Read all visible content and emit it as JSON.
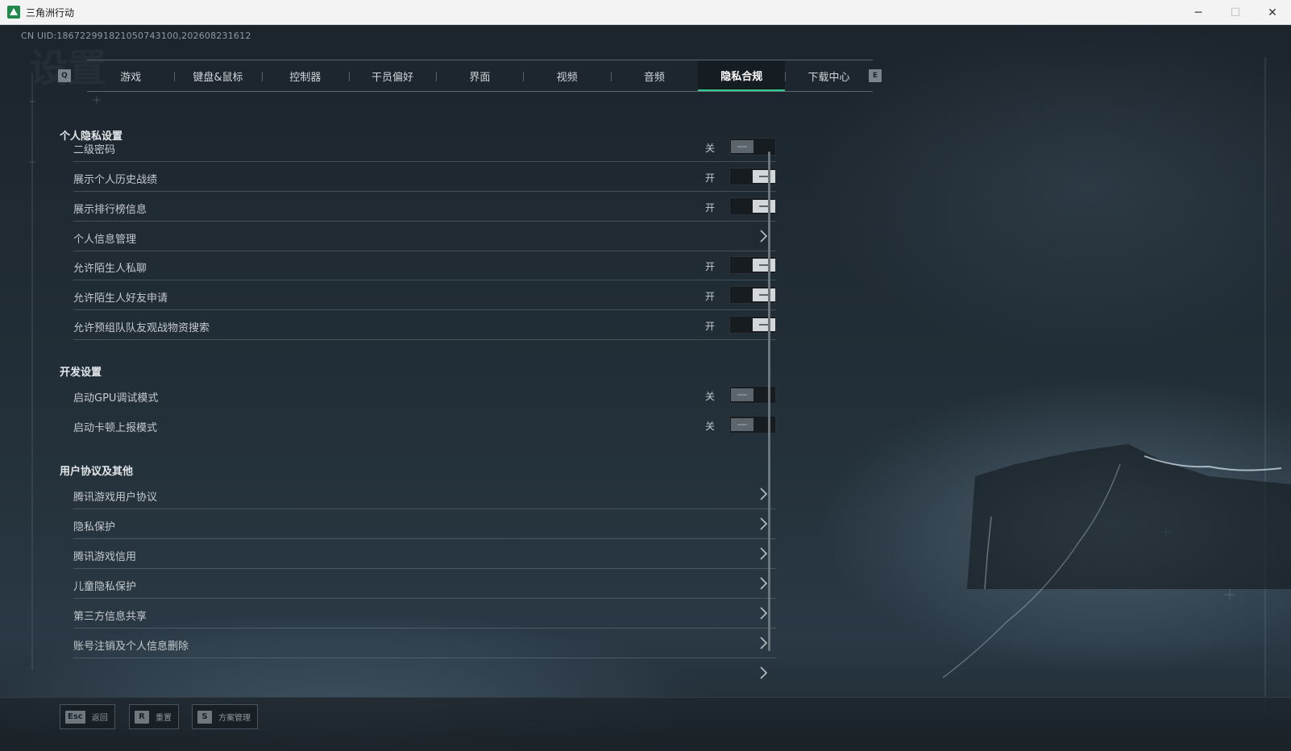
{
  "window": {
    "title": "三角洲行动",
    "minimize_glyph": "─",
    "maximize_glyph": "☐",
    "close_glyph": "✕"
  },
  "uid_text": "CN UID:18672299182105074310​0,202608231612",
  "watermark": "设置",
  "tabs": {
    "prev_key": "Q",
    "next_key": "E",
    "items": [
      {
        "label": "游戏"
      },
      {
        "label": "键盘&鼠标"
      },
      {
        "label": "控制器"
      },
      {
        "label": "干员偏好"
      },
      {
        "label": "界面"
      },
      {
        "label": "视频"
      },
      {
        "label": "音频"
      },
      {
        "label": "隐私合规",
        "active": true
      },
      {
        "label": "下载中心"
      }
    ]
  },
  "sections": {
    "privacy": {
      "title": "个人隐私设置",
      "rows": [
        {
          "label": "二级密码",
          "state": "关",
          "on": false
        },
        {
          "label": "展示个人历史战绩",
          "state": "开",
          "on": true
        },
        {
          "label": "展示排行榜信息",
          "state": "开",
          "on": true
        },
        {
          "label": "个人信息管理",
          "link": true
        },
        {
          "label": "允许陌生人私聊",
          "state": "开",
          "on": true
        },
        {
          "label": "允许陌生人好友申请",
          "state": "开",
          "on": true
        },
        {
          "label": "允许预组队队友观战物资搜索",
          "state": "开",
          "on": true
        }
      ]
    },
    "dev": {
      "title": "开发设置",
      "rows": [
        {
          "label": "启动GPU调试模式",
          "state": "关",
          "on": false
        },
        {
          "label": "启动卡顿上报模式",
          "state": "关",
          "on": false
        }
      ]
    },
    "agreements": {
      "title": "用户协议及其他",
      "rows": [
        {
          "label": "腾讯游戏用户协议",
          "link": true
        },
        {
          "label": "隐私保护",
          "link": true
        },
        {
          "label": "腾讯游戏信用",
          "link": true
        },
        {
          "label": "儿童隐私保护",
          "link": true
        },
        {
          "label": "第三方信息共享",
          "link": true
        },
        {
          "label": "账号注销及个人信息删除",
          "link": true
        }
      ]
    }
  },
  "footer": {
    "back": {
      "key": "Esc",
      "label": "返回"
    },
    "reset": {
      "key": "R",
      "label": "重置"
    },
    "scheme": {
      "key": "S",
      "label": "方案管理"
    }
  },
  "colors": {
    "accent": "#2fcf8f",
    "background": "#1b222a"
  }
}
